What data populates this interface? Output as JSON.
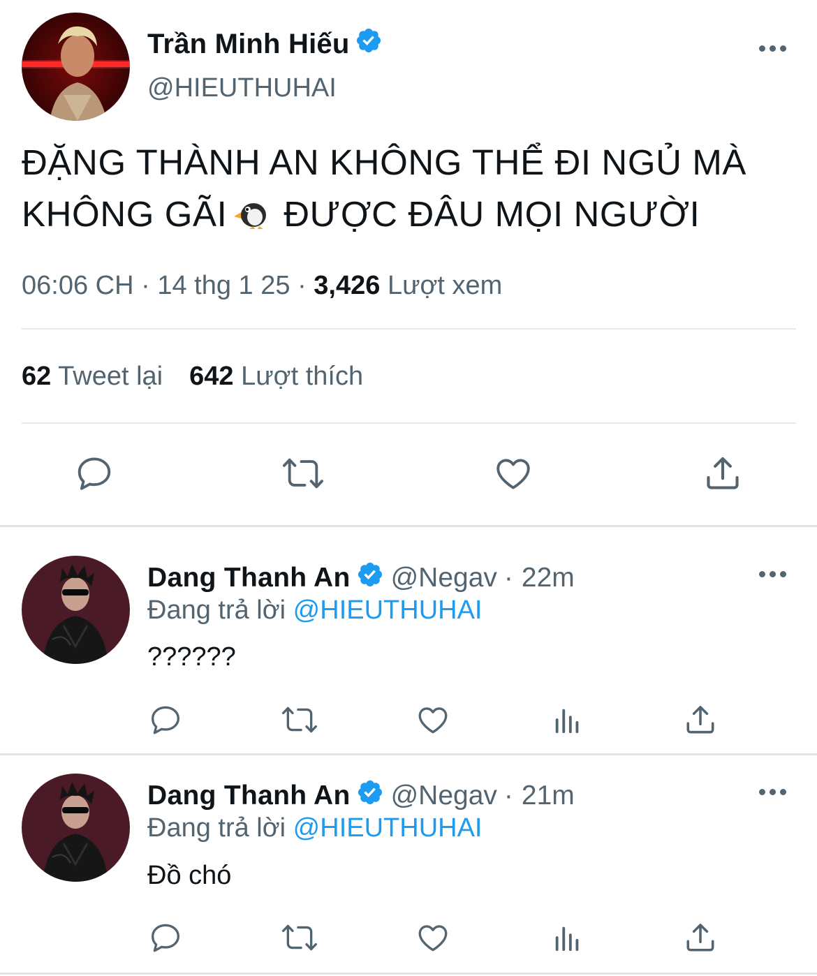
{
  "main_tweet": {
    "display_name": "Trần Minh Hiếu",
    "handle": "@HIEUTHUHAI",
    "text_before_emoji": "ĐẶNG THÀNH AN KHÔNG THỂ ĐI NGỦ MÀ KHÔNG GÃI",
    "emoji": "penguin-emoji",
    "text_after_emoji": "ĐƯỢC ĐÂU MỌI NGƯỜI",
    "time": "06:06 CH",
    "date": "14 thg 1 25",
    "separator": "·",
    "views_count": "3,426",
    "views_label": "Lượt xem",
    "retweets_count": "62",
    "retweets_label": "Tweet lại",
    "likes_count": "642",
    "likes_label": "Lượt thích",
    "actions": [
      "reply-icon",
      "retweet-icon",
      "like-icon",
      "share-icon"
    ]
  },
  "replies": [
    {
      "display_name": "Dang Thanh An",
      "handle": "@Negav",
      "separator": "·",
      "time": "22m",
      "replying_prefix": "Đang trả lời",
      "replying_to": "@HIEUTHUHAI",
      "text": "??????",
      "actions": [
        "reply-icon",
        "retweet-icon",
        "like-icon",
        "views-icon",
        "share-icon"
      ]
    },
    {
      "display_name": "Dang Thanh An",
      "handle": "@Negav",
      "separator": "·",
      "time": "21m",
      "replying_prefix": "Đang trả lời",
      "replying_to": "@HIEUTHUHAI",
      "text": "Đồ chó",
      "actions": [
        "reply-icon",
        "retweet-icon",
        "like-icon",
        "views-icon",
        "share-icon"
      ]
    }
  ],
  "colors": {
    "verified": "#1d9bf0",
    "mention": "#1d9bf0",
    "secondary_text": "#536471",
    "primary_text": "#0f1419",
    "divider": "#e6e9eb"
  }
}
